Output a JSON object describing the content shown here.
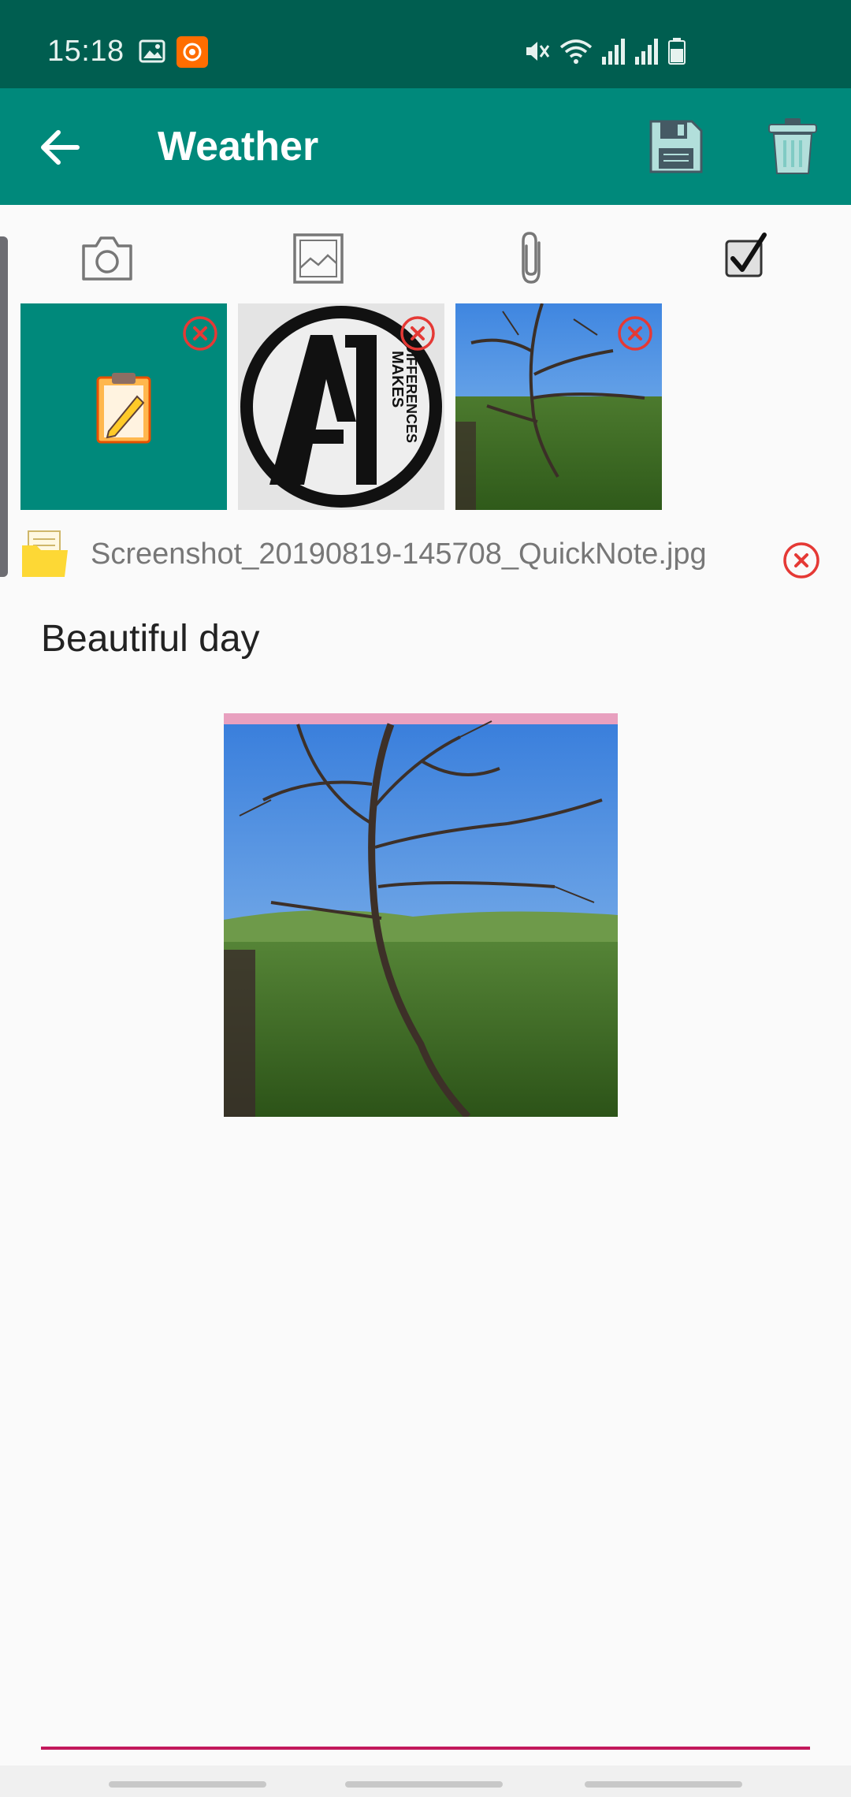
{
  "status_bar": {
    "time": "15:18",
    "icons": [
      "gallery-icon",
      "screen-recorder-icon",
      "mute-icon",
      "wifi-icon",
      "signal-icon",
      "signal-icon",
      "battery-icon"
    ]
  },
  "app_bar": {
    "title": "Weather",
    "icons": [
      "back-arrow-icon",
      "save-icon",
      "trash-icon"
    ]
  },
  "toolbar": {
    "icons": [
      "camera-icon",
      "image-icon",
      "paperclip-icon",
      "checkbox-icon"
    ]
  },
  "attachments": {
    "thumbnails": [
      {
        "type": "app-icon",
        "icon": "clipboard-pencil-icon"
      },
      {
        "type": "logo",
        "logo_text_main": "A1",
        "logo_text_side": "MAKES DIFFERENCES"
      },
      {
        "type": "photo",
        "subject": "tree branches over green hills"
      }
    ],
    "file_name": "Screenshot_20190819-145708_QuickNote.jpg"
  },
  "note": {
    "body": "Beautiful day"
  },
  "colors": {
    "status_bar": "#005e50",
    "app_bar": "#00897b",
    "accent_underline": "#c2185b",
    "remove_icon": "#e53935"
  }
}
